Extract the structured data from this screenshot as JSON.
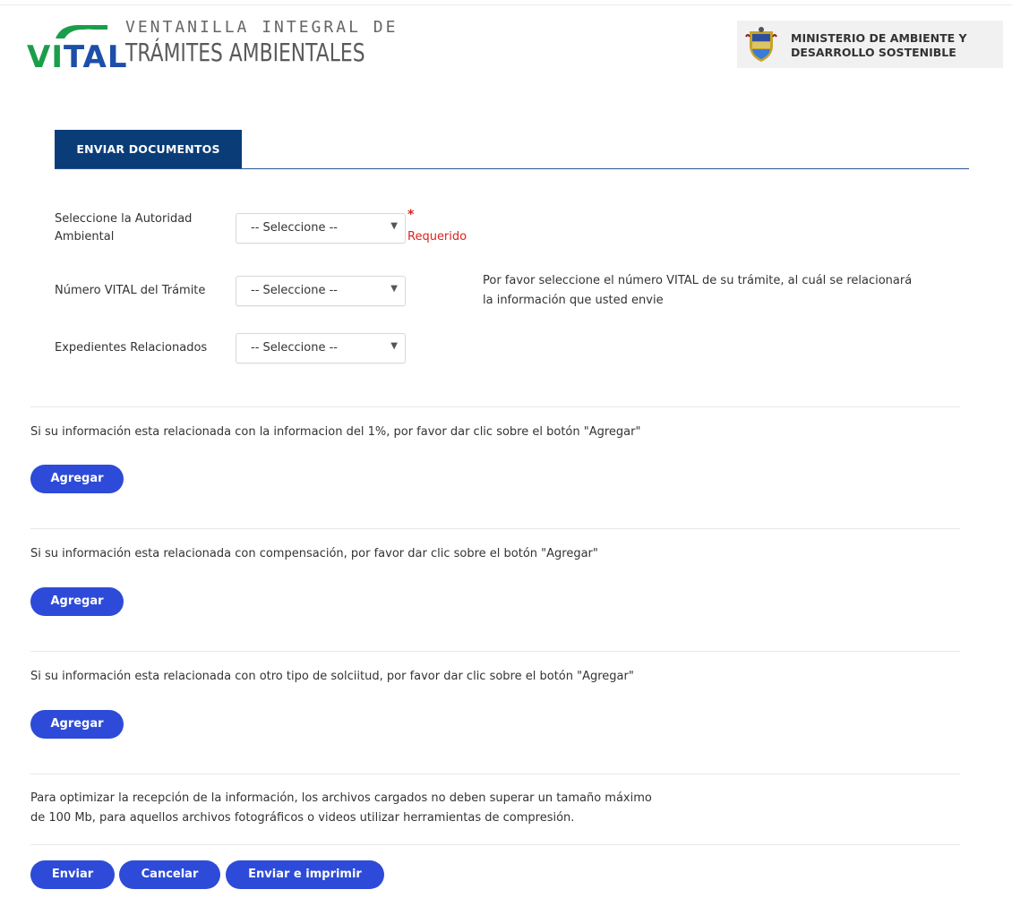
{
  "header": {
    "logo_word_1": "VI",
    "logo_word_2": "TAL",
    "logo_line1": "VENTANILLA INTEGRAL DE",
    "logo_line2": "TRÁMITES AMBIENTALES",
    "ministry": "MINISTERIO DE AMBIENTE Y\nDESARROLLO SOSTENIBLE",
    "crest_icon": "colombia-coat-of-arms"
  },
  "tab": {
    "label": "ENVIAR DOCUMENTOS"
  },
  "form": {
    "authority_label": "Seleccione la Autoridad Ambiental",
    "authority_value": "-- Seleccione --",
    "required_star": "*",
    "required_text": "Requerido",
    "vital_label": "Número VITAL del Trámite",
    "vital_value": "-- Seleccione --",
    "vital_help": "Por favor seleccione el número VITAL de su trámite, al cuál se relacionará la información que usted envie",
    "expedientes_label": "Expedientes Relacionados",
    "expedientes_value": "-- Seleccione --"
  },
  "sections": [
    {
      "text": "Si su información esta relacionada con la informacion del 1%, por favor dar clic sobre el botón \"Agregar\"",
      "button": "Agregar"
    },
    {
      "text": "Si su información esta relacionada con compensación, por favor dar clic sobre el botón \"Agregar\"",
      "button": "Agregar"
    },
    {
      "text": "Si su información esta relacionada con otro tipo de solciitud, por favor dar clic sobre el botón \"Agregar\"",
      "button": "Agregar"
    }
  ],
  "notice": {
    "line1": "Para optimizar la recepción de la información, los archivos cargados no deben superar un tamaño máximo",
    "line2": "de 100 Mb, para aquellos archivos fotográficos o videos utilizar herramientas de compresión."
  },
  "actions": {
    "send": "Enviar",
    "cancel": "Cancelar",
    "send_print": "Enviar e imprimir"
  },
  "colors": {
    "primary_button": "#2d4bd8",
    "tab": "#0a3d78",
    "required": "#e02020",
    "logo_green": "#1b9e4b",
    "logo_blue": "#1d4ea8"
  }
}
